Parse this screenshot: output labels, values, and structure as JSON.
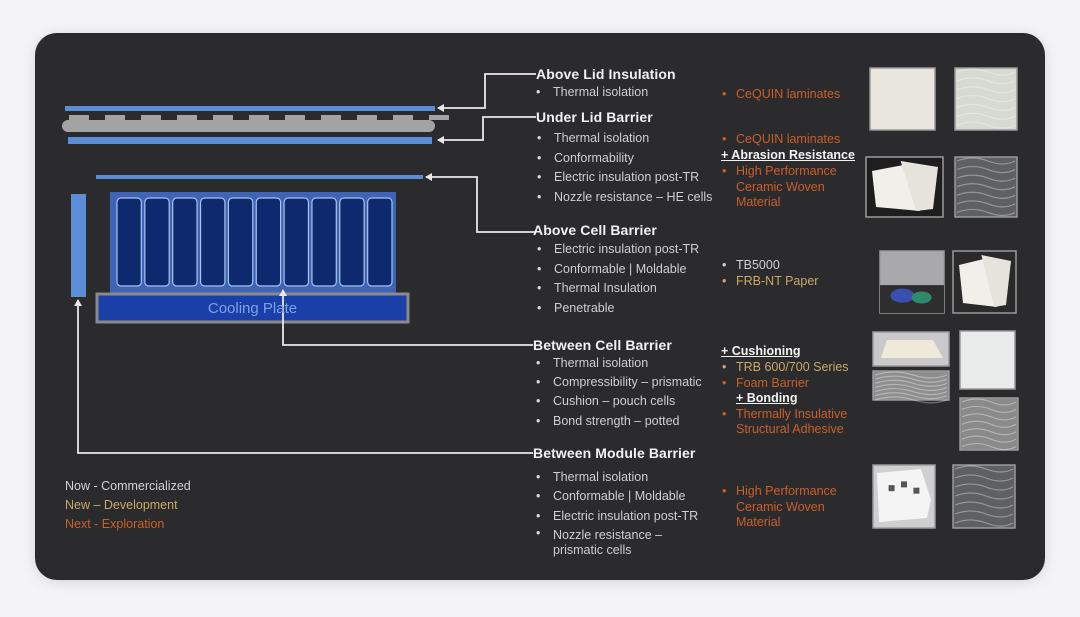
{
  "colors": {
    "background": "#2b2a2c",
    "now": "#d2d2d2",
    "new": "#c9a86a",
    "next": "#c8602a",
    "barrier_blue": "#5b8ed6",
    "cell_dark": "#0d2a6e",
    "cooling_plate": "#1b3fa8",
    "lid_gray": "#a3a3a3"
  },
  "diagram": {
    "cooling_plate_label": "Cooling Plate",
    "cell_count": 10
  },
  "sections": [
    {
      "title": "Above Lid Insulation",
      "properties": [
        "Thermal isolation"
      ],
      "materials": [
        {
          "text": "CeQUIN laminates",
          "status": "next"
        }
      ],
      "tags": [],
      "images": [
        "white-laminate-sheet",
        "textured-white-laminate"
      ]
    },
    {
      "title": "Under Lid Barrier",
      "properties": [
        "Thermal isolation",
        "Conformability",
        "Electric insulation post-TR",
        "Nozzle resistance – HE cells"
      ],
      "materials": [
        {
          "text": "CeQUIN laminates",
          "status": "next"
        },
        {
          "text": "High Performance Ceramic Woven Material",
          "status": "next"
        }
      ],
      "tags": [
        "+ Abrasion Resistance"
      ],
      "images": [
        "white-paper-sheets",
        "gray-woven-fabric"
      ]
    },
    {
      "title": "Above Cell Barrier",
      "properties": [
        "Electric insulation post-TR",
        "Conformable | Moldable",
        "Thermal Insulation",
        "Penetrable"
      ],
      "materials": [
        {
          "text": "TB5000",
          "status": "now"
        },
        {
          "text": "FRB-NT Paper",
          "status": "new"
        }
      ],
      "tags": [],
      "images": [
        "barrier-installation-photo",
        "cream-paper-sheets"
      ]
    },
    {
      "title": "Between Cell Barrier",
      "properties": [
        "Thermal isolation",
        "Compressibility – prismatic",
        "Cushion – pouch cells",
        "Bond strength – potted"
      ],
      "materials": [
        {
          "text": "TRB 600/700 Series",
          "status": "new"
        },
        {
          "text": "Foam Barrier",
          "status": "next"
        },
        {
          "text": "Thermally Insulative Structural Adhesive",
          "status": "next"
        }
      ],
      "tags": [
        "+ Cushioning",
        "+ Bonding"
      ],
      "images": [
        "cushion-pad",
        "foam-cross-section",
        "white-square-pad",
        "adhesive-closeup"
      ]
    },
    {
      "title": "Between Module Barrier",
      "properties": [
        "Thermal isolation",
        "Conformable | Moldable",
        "Electric insulation post-TR",
        "Nozzle resistance – prismatic cells"
      ],
      "materials": [
        {
          "text": "High Performance Ceramic Woven Material",
          "status": "next"
        }
      ],
      "tags": [],
      "images": [
        "ceramic-plate-part",
        "gray-woven-fabric"
      ]
    }
  ],
  "legend": [
    {
      "text": "Now - Commercialized",
      "status": "now"
    },
    {
      "text": "New – Development",
      "status": "new"
    },
    {
      "text": "Next - Exploration",
      "status": "next"
    }
  ]
}
